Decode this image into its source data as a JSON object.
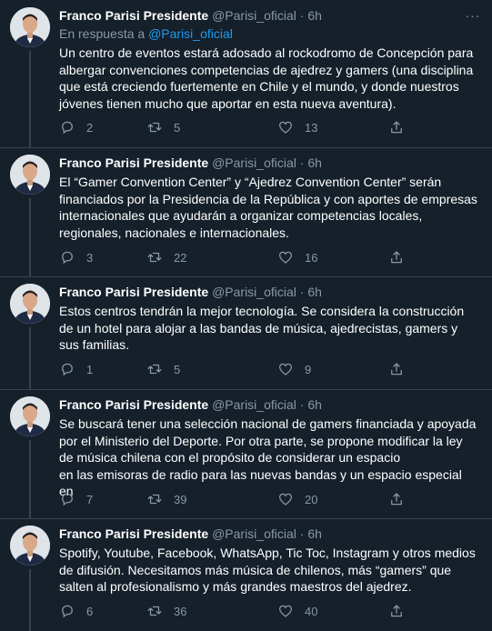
{
  "colors": {
    "background": "#15202b",
    "text": "#ffffff",
    "muted": "#8899a6",
    "link": "#1d9bf0",
    "divider": "#38444d"
  },
  "tweets": [
    {
      "name": "Franco Parisi Presidente",
      "handle": "@Parisi_oficial",
      "dot": "·",
      "time": "6h",
      "reply_prefix": "En respuesta a",
      "reply_handle": "@Parisi_oficial",
      "text": "Un centro de eventos estará adosado al rockodromo de Concepción para albergar convenciones competencias de ajedrez y gamers (una disciplina que está creciendo fuertemente en Chile y el mundo, y donde nuestros jóvenes tienen mucho que aportar en esta nueva aventura).",
      "replies": "2",
      "retweets": "5",
      "likes": "13"
    },
    {
      "name": "Franco Parisi Presidente",
      "handle": "@Parisi_oficial",
      "dot": "·",
      "time": "6h",
      "text": "El “Gamer Convention Center” y “Ajedrez Convention Center” serán financiados por la Presidencia de la República y con aportes de empresas internacionales que ayudarán a organizar competencias locales, regionales, nacionales e internacionales.",
      "replies": "3",
      "retweets": "22",
      "likes": "16"
    },
    {
      "name": "Franco Parisi Presidente",
      "handle": "@Parisi_oficial",
      "dot": "·",
      "time": "6h",
      "text": "Estos centros tendrán la mejor tecnología. Se considera la construcción de un hotel para alojar a las bandas de música, ajedrecistas, gamers y sus familias.",
      "replies": "1",
      "retweets": "5",
      "likes": "9"
    },
    {
      "name": "Franco Parisi Presidente",
      "handle": "@Parisi_oficial",
      "dot": "·",
      "time": "6h",
      "text": "Se buscará tener una selección nacional de gamers financiada y apoyada por el Ministerio del Deporte. Por otra parte, se propone modificar la ley de música chilena con el propósito de considerar un espacio\nen las emisoras de radio para las nuevas bandas y un espacio especial en",
      "replies": "7",
      "retweets": "39",
      "likes": "20"
    },
    {
      "name": "Franco Parisi Presidente",
      "handle": "@Parisi_oficial",
      "dot": "·",
      "time": "6h",
      "text": "Spotify, Youtube, Facebook, WhatsApp, Tic Toc, Instagram y otros medios de difusión. Necesitamos más música de chilenos, más “gamers” que salten al profesionalismo y más grandes maestros del ajedrez.",
      "replies": "6",
      "retweets": "36",
      "likes": "40"
    }
  ]
}
